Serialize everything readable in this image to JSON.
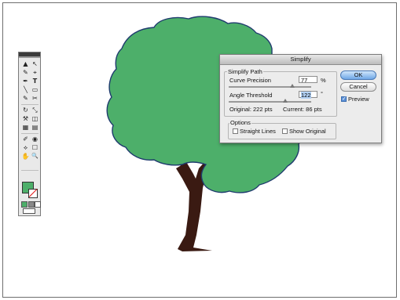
{
  "dialog": {
    "title": "Simplify",
    "simplify_path_label": "Simplify Path",
    "curve_precision_label": "Curve Precision",
    "curve_precision_value": "77",
    "curve_precision_unit": "%",
    "angle_threshold_label": "Angle Threshold",
    "angle_threshold_value": "122",
    "angle_threshold_unit": "°",
    "original_points": "Original: 222 pts",
    "current_points": "Current: 86 pts",
    "options_label": "Options",
    "straight_lines_label": "Straight Lines",
    "straight_lines_checked": false,
    "show_original_label": "Show Original",
    "show_original_checked": false,
    "ok_label": "OK",
    "cancel_label": "Cancel",
    "preview_label": "Preview",
    "preview_checked": true,
    "check_glyph": "✓"
  },
  "tools": {
    "icons": [
      "▲",
      "↖",
      "✎",
      "⌖",
      "✒",
      "T",
      "╲",
      "▭",
      "✎",
      "✂",
      "↻",
      "⤡",
      "⚒",
      "◫",
      "▦",
      "▤",
      "✐",
      "◉",
      "⟡",
      "☐",
      "✋",
      "🔍"
    ]
  },
  "artwork": {
    "canopy_color": "#4daf6a",
    "trunk_color": "#3a1a12"
  }
}
